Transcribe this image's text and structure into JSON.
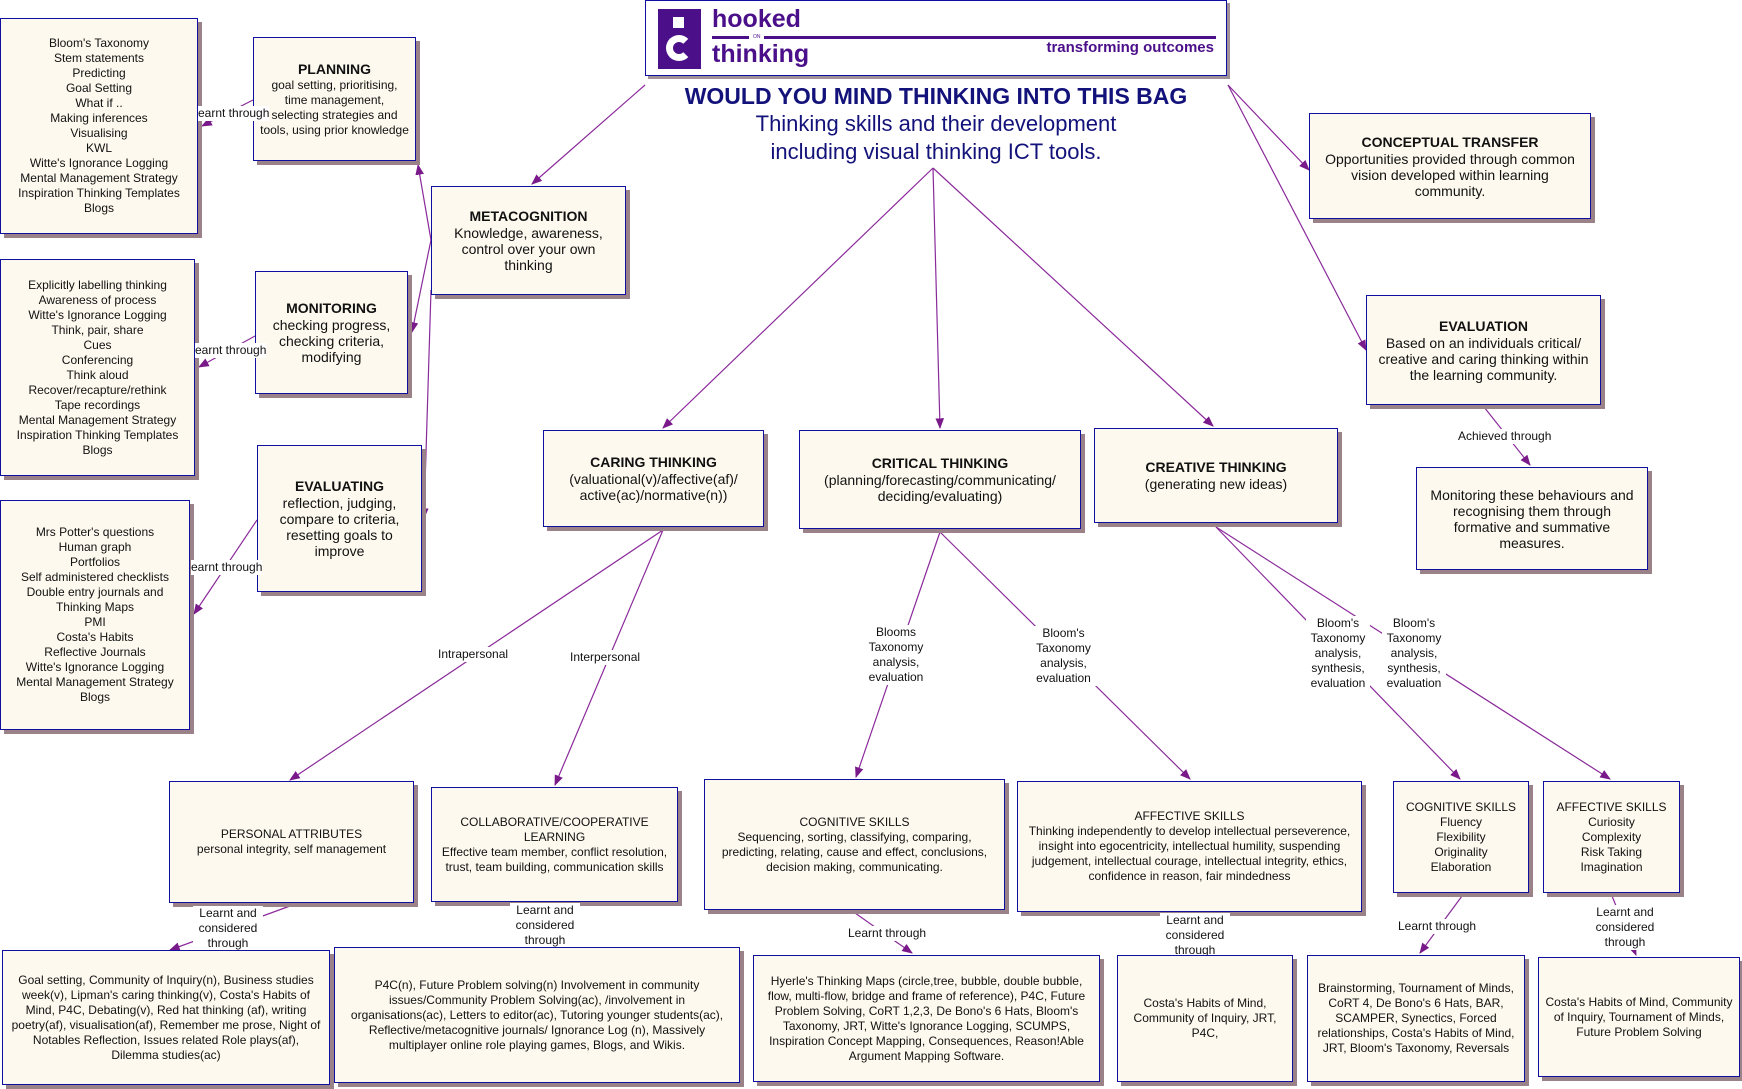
{
  "logo": {
    "word1": "hooked",
    "word_on": "ON",
    "word2": "thinking",
    "tagline": "transforming outcomes",
    "brand_color": "#4b0f8a"
  },
  "header": {
    "title": "WOULD YOU MIND THINKING INTO THIS BAG",
    "subtitle_line1": "Thinking skills and their development",
    "subtitle_line2": "including visual thinking ICT tools."
  },
  "colors": {
    "node_fill": "#fdf9ee",
    "node_border": "#1010a0",
    "node_shadow": "#9a8288",
    "link": "#8a2a9a",
    "title_text": "#12127a"
  },
  "nodes": {
    "metacognition": {
      "title": "METACOGNITION",
      "desc": "Knowledge, awareness, control over your own thinking"
    },
    "planning": {
      "title": "PLANNING",
      "desc": "goal setting, prioritising, time management, selecting strategies and tools, using prior knowledge"
    },
    "monitoring": {
      "title": "MONITORING",
      "desc": "checking progress, checking criteria, modifying"
    },
    "evaluating": {
      "title": "EVALUATING",
      "desc": "reflection, judging, compare to criteria, resetting goals to improve"
    },
    "planning_tools": {
      "items": [
        "Bloom's Taxonomy",
        "Stem statements",
        "Predicting",
        "Goal Setting",
        "What if ..",
        "Making inferences",
        "Visualising",
        "KWL",
        "Witte's Ignorance Logging",
        "Mental Management Strategy",
        "Inspiration Thinking Templates",
        "Blogs"
      ]
    },
    "monitoring_tools": {
      "items": [
        "Explicitly labelling thinking",
        "Awareness of process",
        "Witte's Ignorance Logging",
        "Think, pair, share",
        "Cues",
        "Conferencing",
        "Think aloud",
        "Recover/recapture/rethink",
        "Tape recordings",
        "Mental Management Strategy",
        "Inspiration Thinking Templates",
        "Blogs"
      ]
    },
    "evaluating_tools": {
      "items": [
        "Mrs Potter's questions",
        "Human graph",
        "Portfolios",
        "Self administered checklists",
        "Double entry journals and",
        "Thinking Maps",
        "PMI",
        "Costa's Habits",
        "Reflective Journals",
        "Witte's Ignorance Logging",
        "Mental Management Strategy",
        "Blogs"
      ]
    },
    "conceptual_transfer": {
      "title": "CONCEPTUAL  TRANSFER",
      "desc": "Opportunities provided through common vision developed within learning community."
    },
    "evaluation": {
      "title": "EVALUATION",
      "desc": "Based on an individuals critical/ creative and caring thinking within the learning community."
    },
    "evaluation_measures": {
      "desc": "Monitoring these behaviours and recognising them through formative and summative measures."
    },
    "caring": {
      "title": "CARING THINKING",
      "desc": "(valuational(v)/affective(af)/ active(ac)/normative(n))"
    },
    "critical": {
      "title": "CRITICAL THINKING",
      "desc": "(planning/forecasting/communicating/ deciding/evaluating)"
    },
    "creative": {
      "title": "CREATIVE THINKING",
      "desc": "(generating new ideas)"
    },
    "personal_attributes": {
      "title": "PERSONAL ATTRIBUTES",
      "desc": "personal integrity, self management"
    },
    "collaborative": {
      "title": "COLLABORATIVE/COOPERATIVE LEARNING",
      "desc": "Effective team member, conflict resolution, trust, team building, communication skills"
    },
    "critical_cognitive": {
      "title": "COGNITIVE SKILLS",
      "desc": "Sequencing, sorting, classifying, comparing, predicting, relating, cause and effect, conclusions, decision making, communicating."
    },
    "critical_affective": {
      "title": "AFFECTIVE SKILLS",
      "desc": "Thinking independently to develop intellectual perseverence, insight into egocentricity, intellectual humility, suspending judgement, intellectual courage, intellectual integrity, ethics, confidence in reason, fair mindedness"
    },
    "creative_cognitive": {
      "title": "COGNITIVE SKILLS",
      "items": [
        "Fluency",
        "Flexibility",
        "Originality",
        "Elaboration"
      ]
    },
    "creative_affective": {
      "title": "AFFECTIVE SKILLS",
      "items": [
        "Curiosity",
        "Complexity",
        "Risk Taking",
        "Imagination"
      ]
    },
    "personal_tools": {
      "desc": "Goal setting, Community of Inquiry(n), Business studies week(v), Lipman's caring thinking(v), Costa's Habits of Mind, P4C, Debating(v), Red hat thinking (af), writing poetry(af), visualisation(af), Remember me prose, Night of Notables Reflection, Issues related Role plays(af), Dilemma studies(ac)"
    },
    "collaborative_tools": {
      "desc": "P4C(n), Future Problem solving(n) Involvement  in community issues/Community Problem Solving(ac), /involvement in organisations(ac), Letters to editor(ac), Tutoring younger students(ac), Reflective/metacognitive journals/ Ignorance Log (n), Massively multiplayer online role playing games, Blogs, and Wikis."
    },
    "critical_cognitive_tools": {
      "desc": "Hyerle's Thinking Maps (circle,tree, bubble, double bubble, flow, multi-flow, bridge and frame of reference), P4C, Future Problem Solving, CoRT 1,2,3, De Bono's 6 Hats, Bloom's Taxonomy, JRT, Witte's Ignorance Logging, SCUMPS, Inspiration Concept Mapping, Consequences, Reason!Able Argument Mapping Software."
    },
    "critical_affective_tools": {
      "desc": "Costa's Habits of Mind, Community of Inquiry, JRT, P4C,"
    },
    "creative_cognitive_tools": {
      "desc": "Brainstorming, Tournament of Minds, CoRT 4, De Bono's 6 Hats, BAR, SCAMPER, Synectics, Forced relationships, Costa's Habits of Mind, JRT, Bloom's Taxonomy, Reversals"
    },
    "creative_affective_tools": {
      "desc": "Costa's Habits of Mind, Community of Inquiry, Tournament of Minds, Future Problem Solving"
    }
  },
  "link_labels": {
    "learnt_through": "Learnt through",
    "learnt_through_clipped": "earnt through",
    "learnt_considered": "Learnt and considered through",
    "achieved_through": "Achieved through",
    "intrapersonal": "Intrapersonal",
    "interpersonal": "Interpersonal",
    "blooms_ae": "Blooms Taxonomy analysis, evaluation",
    "blooms2_ae": "Bloom's Taxonomy analysis, evaluation",
    "blooms_ase": "Bloom's Taxonomy analysis, synthesis, evaluation"
  }
}
